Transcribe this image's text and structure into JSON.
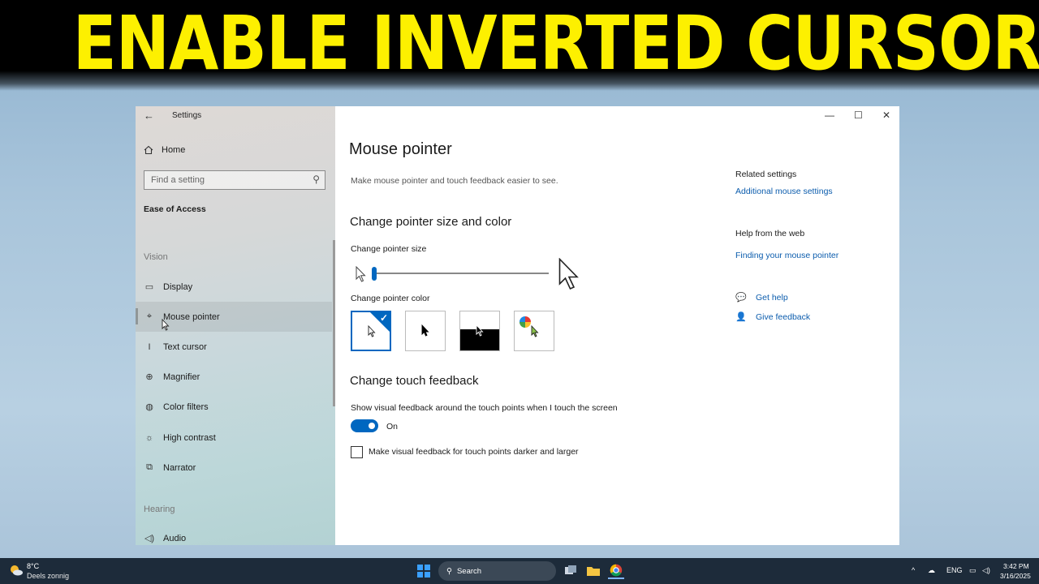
{
  "headline": "ENABLE INVERTED CURSOR",
  "window": {
    "app_title": "Settings",
    "controls": {
      "minimize": "—",
      "maximize": "☐",
      "close": "✕"
    }
  },
  "sidebar": {
    "home_label": "Home",
    "search_placeholder": "Find a setting",
    "section": "Ease of Access",
    "groups": {
      "vision": "Vision",
      "hearing": "Hearing"
    },
    "items": [
      {
        "label": "Display",
        "icon": "monitor-icon"
      },
      {
        "label": "Mouse pointer",
        "icon": "mouse-pointer-icon",
        "active": true
      },
      {
        "label": "Text cursor",
        "icon": "text-cursor-icon"
      },
      {
        "label": "Magnifier",
        "icon": "magnifier-icon"
      },
      {
        "label": "Color filters",
        "icon": "color-filters-icon"
      },
      {
        "label": "High contrast",
        "icon": "high-contrast-icon"
      },
      {
        "label": "Narrator",
        "icon": "narrator-icon"
      },
      {
        "label": "Audio",
        "icon": "audio-icon"
      }
    ]
  },
  "main": {
    "title": "Mouse pointer",
    "description": "Make mouse pointer and touch feedback easier to see.",
    "size_color_heading": "Change pointer size and color",
    "size_label": "Change pointer size",
    "pointer_size": 1,
    "color_label": "Change pointer color",
    "color_options": [
      "white",
      "black",
      "inverted",
      "custom"
    ],
    "selected_color": "white",
    "touch_heading": "Change touch feedback",
    "touch_label": "Show visual feedback around the touch points when I touch the screen",
    "toggle_state": "On",
    "toggle_on": true,
    "checkbox_label": "Make visual feedback for touch points darker and larger",
    "checkbox_checked": false
  },
  "related": {
    "heading": "Related settings",
    "link": "Additional mouse settings",
    "web_heading": "Help from the web",
    "web_link": "Finding your mouse pointer",
    "get_help": "Get help",
    "give_feedback": "Give feedback"
  },
  "taskbar": {
    "temperature": "8°C",
    "weather": "Deels zonnig",
    "search_label": "Search",
    "language": "ENG",
    "time": "3:42 PM",
    "date": "3/16/2025"
  },
  "colors": {
    "accent": "#0067c0",
    "headline": "#fdf000",
    "link": "#0b5cad"
  }
}
